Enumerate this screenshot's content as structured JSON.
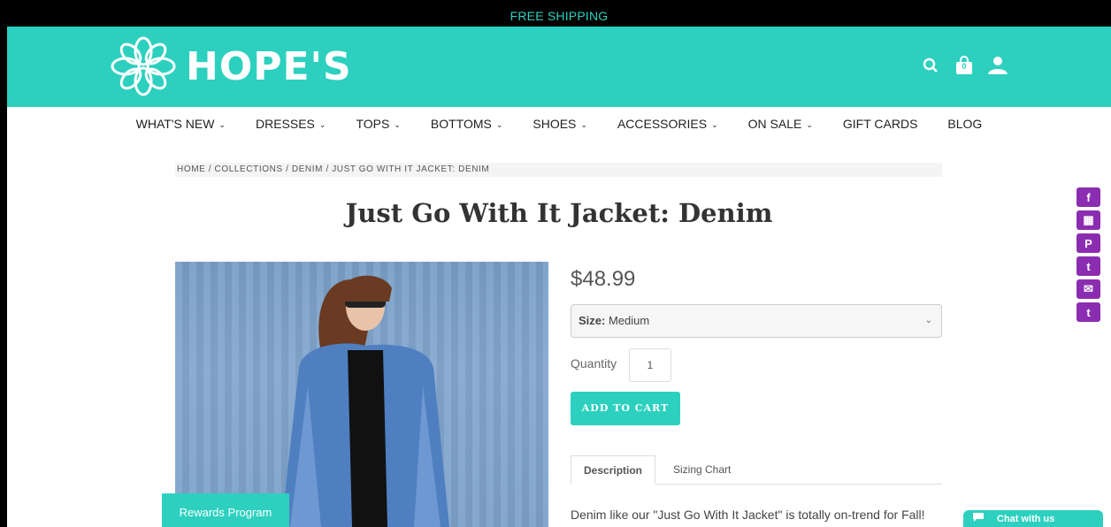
{
  "topbar": {
    "text": "FREE SHIPPING"
  },
  "brand": {
    "name": "HOPE'S",
    "color": "#2dd0bf"
  },
  "header_icons": [
    "search-icon",
    "bag-icon",
    "user-icon"
  ],
  "cart_count": "0",
  "nav": [
    {
      "label": "WHAT'S NEW",
      "dropdown": true
    },
    {
      "label": "DRESSES",
      "dropdown": true
    },
    {
      "label": "TOPS",
      "dropdown": true
    },
    {
      "label": "BOTTOMS",
      "dropdown": true
    },
    {
      "label": "SHOES",
      "dropdown": true
    },
    {
      "label": "ACCESSORIES",
      "dropdown": true
    },
    {
      "label": "ON SALE",
      "dropdown": true
    },
    {
      "label": "GIFT CARDS",
      "dropdown": false
    },
    {
      "label": "BLOG",
      "dropdown": false
    }
  ],
  "breadcrumb": "HOME / COLLECTIONS / DENIM / JUST GO WITH IT JACKET: DENIM",
  "product": {
    "title": "Just Go With It Jacket: Denim",
    "price": "$48.99",
    "size_label": "Size:",
    "size_value": "Medium",
    "quantity_label": "Quantity",
    "quantity_value": "1",
    "add_to_cart": "ADD TO CART"
  },
  "tabs": {
    "description": "Description",
    "sizing": "Sizing Chart"
  },
  "description": "Denim like our \"Just Go With It Jacket\" is totally on-trend for Fall!",
  "share_icons": [
    {
      "name": "facebook-icon",
      "glyph": "f"
    },
    {
      "name": "grid-icon",
      "glyph": "▦"
    },
    {
      "name": "pinterest-icon",
      "glyph": "P"
    },
    {
      "name": "twitter-icon",
      "glyph": "t"
    },
    {
      "name": "email-icon",
      "glyph": "✉"
    },
    {
      "name": "tumblr-icon",
      "glyph": "t"
    }
  ],
  "share_color": "#8b2db0",
  "rewards": "Rewards Program",
  "chat": "Chat with us"
}
